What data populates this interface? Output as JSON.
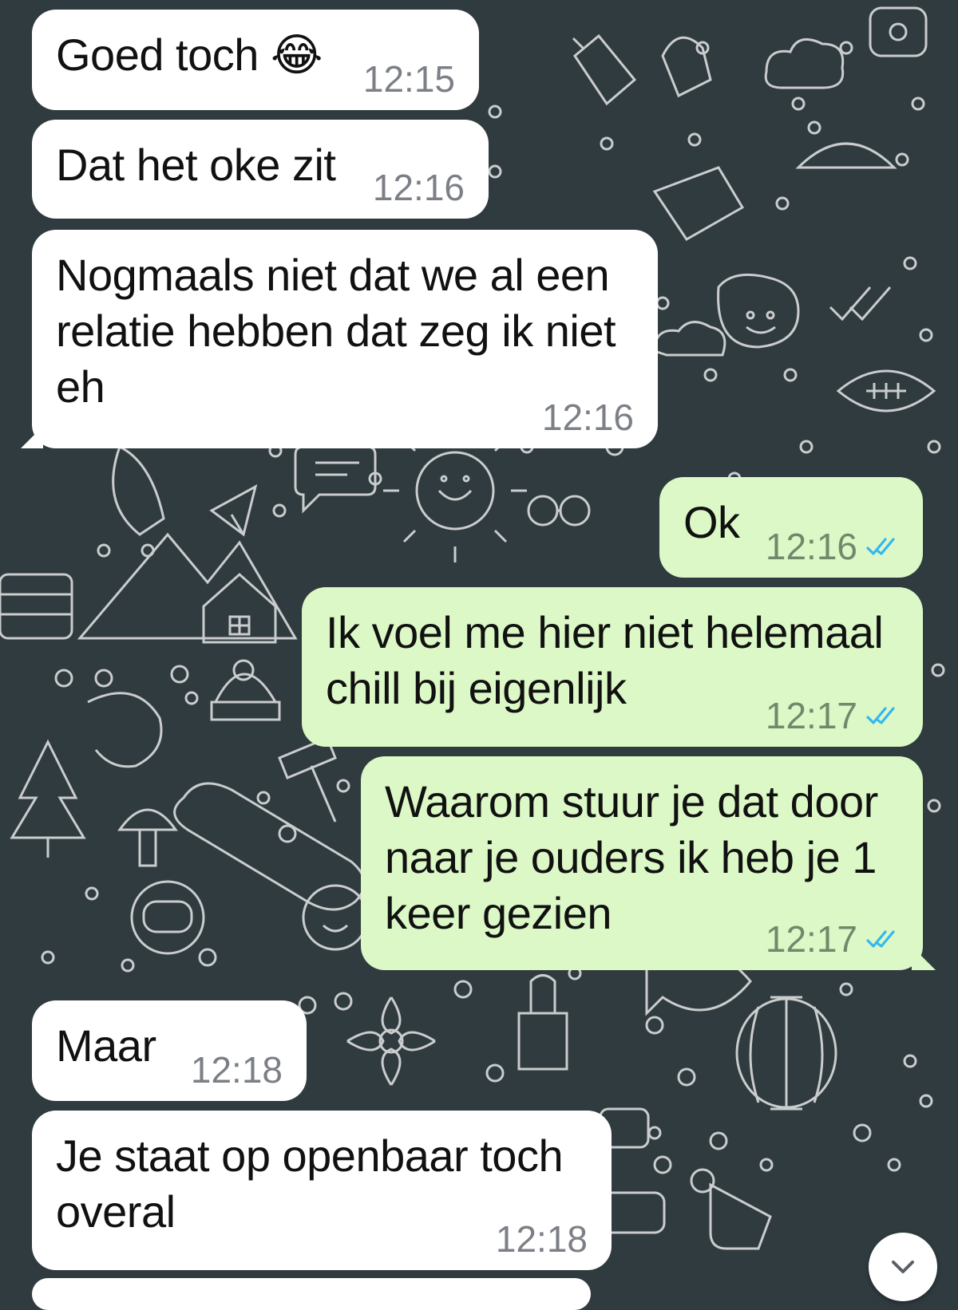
{
  "colors": {
    "wallpaper": "#2f3b3f",
    "wallpaper_doodle": "#e6e6e6",
    "incoming_bubble": "#ffffff",
    "outgoing_bubble": "#dcf8c6",
    "read_ticks": "#34b7f1"
  },
  "messages": [
    {
      "direction": "in",
      "text": "Goed toch 😂",
      "time": "12:15"
    },
    {
      "direction": "in",
      "text": "Dat het oke zit",
      "time": "12:16"
    },
    {
      "direction": "in",
      "text": "Nogmaals niet dat we al een relatie hebben dat zeg ik niet eh",
      "time": "12:16"
    },
    {
      "direction": "out",
      "text": "Ok",
      "time": "12:16",
      "status": "read"
    },
    {
      "direction": "out",
      "text": "Ik voel me hier niet helemaal chill bij eigenlijk",
      "time": "12:17",
      "status": "read"
    },
    {
      "direction": "out",
      "text": "Waarom stuur je dat door naar je ouders ik heb je 1 keer gezien",
      "time": "12:17",
      "status": "read"
    },
    {
      "direction": "in",
      "text": "Maar",
      "time": "12:18"
    },
    {
      "direction": "in",
      "text": "Je staat op openbaar toch overal",
      "time": "12:18"
    }
  ],
  "scroll_button": {
    "icon": "chevron-down-icon"
  }
}
